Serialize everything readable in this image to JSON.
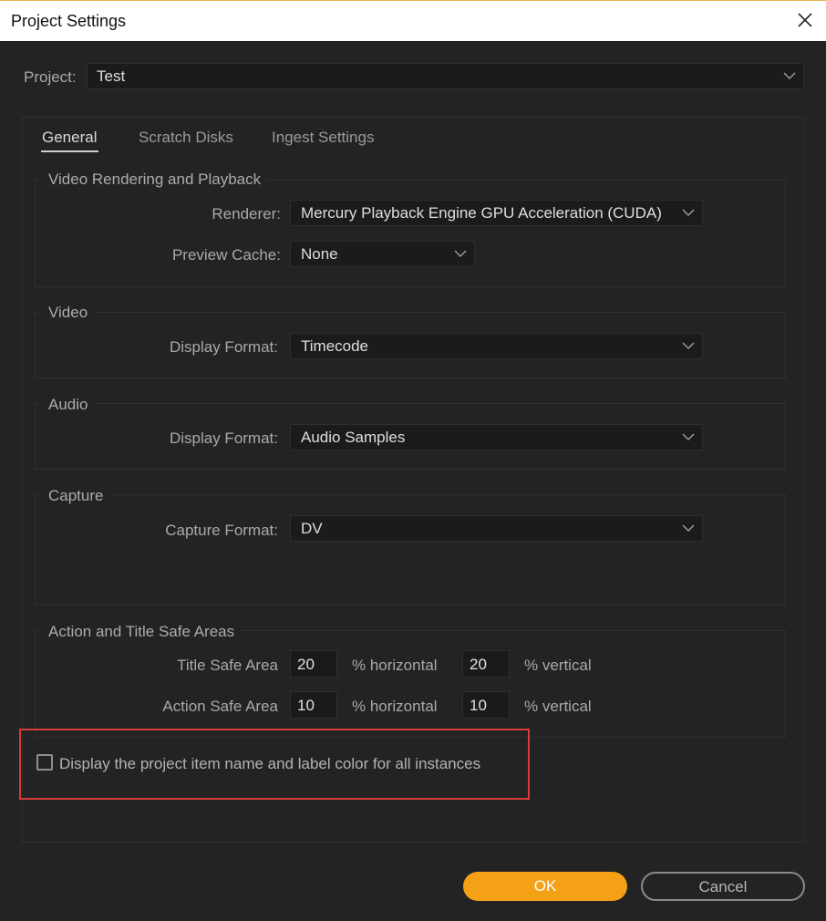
{
  "window": {
    "title": "Project Settings",
    "close_icon": "close-icon"
  },
  "project": {
    "label": "Project:",
    "value": "Test"
  },
  "tabs": [
    {
      "label": "General",
      "active": true
    },
    {
      "label": "Scratch Disks",
      "active": false
    },
    {
      "label": "Ingest Settings",
      "active": false
    }
  ],
  "video_rendering": {
    "title": "Video Rendering and Playback",
    "renderer_label": "Renderer:",
    "renderer_value": "Mercury Playback Engine GPU Acceleration (CUDA)",
    "preview_cache_label": "Preview Cache:",
    "preview_cache_value": "None"
  },
  "video": {
    "title": "Video",
    "display_format_label": "Display Format:",
    "display_format_value": "Timecode"
  },
  "audio": {
    "title": "Audio",
    "display_format_label": "Display Format:",
    "display_format_value": "Audio Samples"
  },
  "capture": {
    "title": "Capture",
    "capture_format_label": "Capture Format:",
    "capture_format_value": "DV"
  },
  "safe_areas": {
    "title": "Action and Title Safe Areas",
    "title_safe_label": "Title Safe Area",
    "title_safe_h": "20",
    "title_safe_v": "20",
    "action_safe_label": "Action Safe Area",
    "action_safe_h": "10",
    "action_safe_v": "10",
    "horizontal_label": "% horizontal",
    "vertical_label": "% vertical"
  },
  "display_option": {
    "label": "Display the project item name and label color for all instances",
    "checked": false
  },
  "buttons": {
    "ok": "OK",
    "cancel": "Cancel"
  },
  "colors": {
    "accent": "#f4a118",
    "highlight": "#d83b3b",
    "background": "#232323"
  }
}
